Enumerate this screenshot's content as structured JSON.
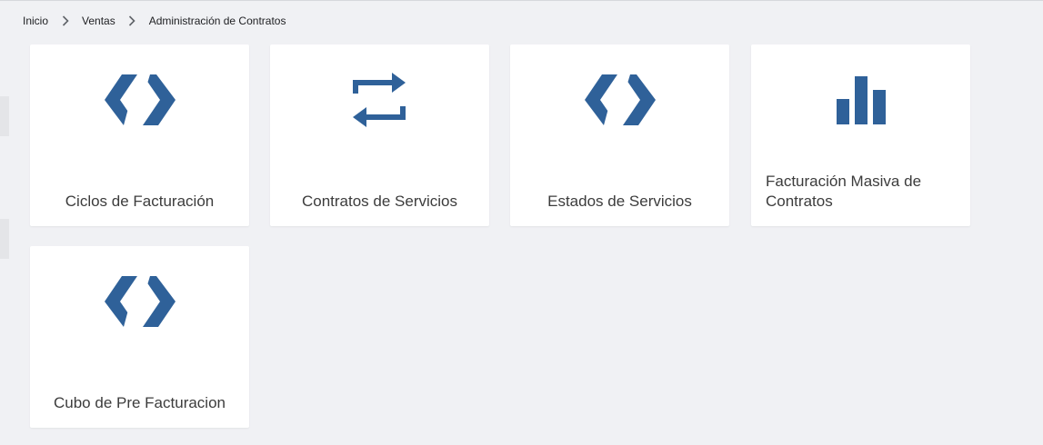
{
  "colors": {
    "icon": "#2f6199",
    "background": "#f0f1f4",
    "card": "#ffffff"
  },
  "breadcrumb": {
    "items": [
      "Inicio",
      "Ventas",
      "Administración de Contratos"
    ],
    "separator_icon": "chevron-right-icon"
  },
  "cards": [
    {
      "label": "Ciclos de Facturación",
      "icon": "code-slash-icon"
    },
    {
      "label": "Contratos de Servicios",
      "icon": "repeat-arrows-icon"
    },
    {
      "label": "Estados de Servicios",
      "icon": "code-slash-icon"
    },
    {
      "label": "Facturación Masiva de Contratos",
      "icon": "bar-chart-icon"
    },
    {
      "label": "Cubo de Pre Facturacion",
      "icon": "code-slash-icon"
    }
  ]
}
